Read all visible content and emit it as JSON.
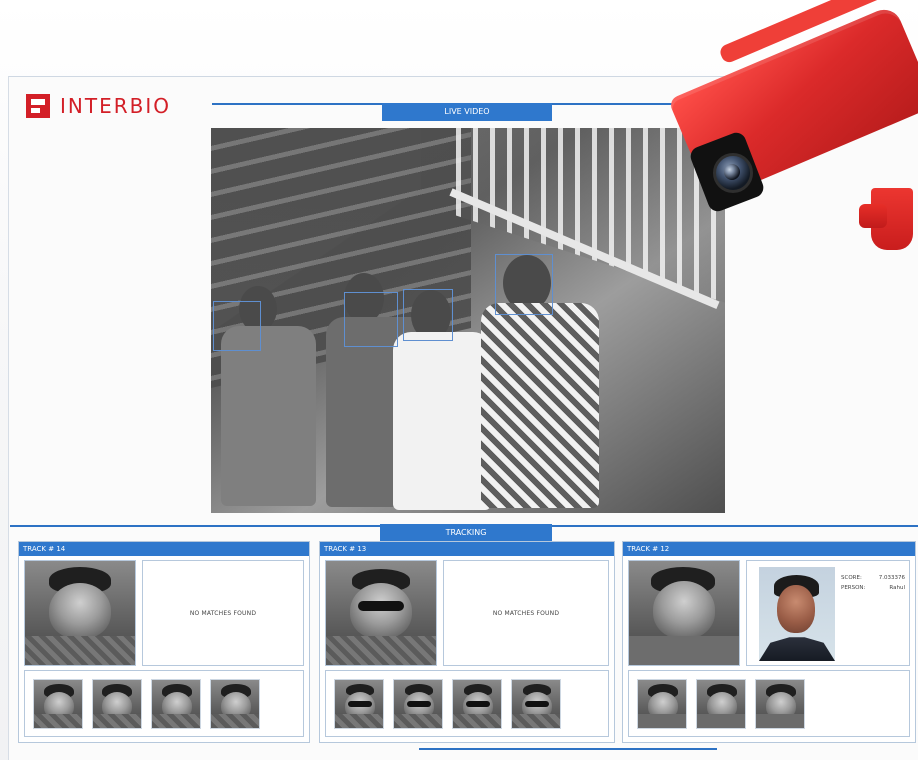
{
  "brand": {
    "name": "INTERBIO"
  },
  "sections": {
    "live_video": "LIVE VIDEO",
    "tracking": "TRACKING"
  },
  "tracks": [
    {
      "title": "TRACK #  14",
      "status": "NO MATCHES FOUND"
    },
    {
      "title": "TRACK #  13",
      "status": "NO MATCHES FOUND"
    },
    {
      "title": "TRACK #  12",
      "score_label": "SCORE:",
      "score_value": "7.033376",
      "person_label": "PERSON:",
      "person_value": "Rahul"
    }
  ],
  "colors": {
    "accent": "#2F78CD",
    "brand_red": "#D31F27",
    "camera_red": "#DB2A2A"
  },
  "icons": {
    "camera": "security-camera-icon"
  }
}
